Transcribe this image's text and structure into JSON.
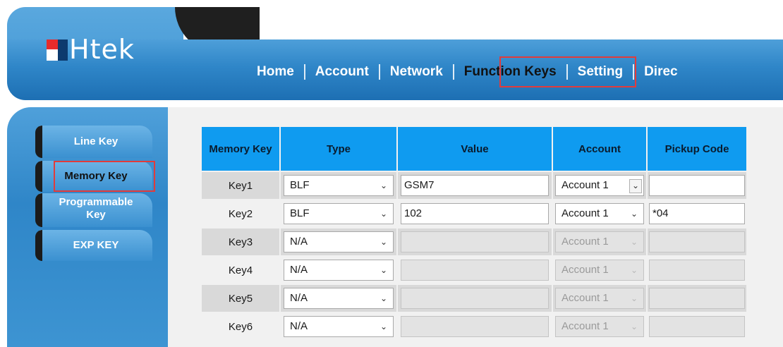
{
  "logo": {
    "text": "Htek"
  },
  "nav": {
    "items": [
      "Home",
      "Account",
      "Network",
      "Function Keys",
      "Setting",
      "Direc"
    ],
    "active": "Function Keys"
  },
  "sidebar": {
    "items": [
      {
        "label": "Line Key"
      },
      {
        "label": "Memory Key"
      },
      {
        "label_line1": "Programmable",
        "label_line2": "Key"
      },
      {
        "label": "EXP KEY"
      }
    ],
    "active": "Memory Key"
  },
  "table": {
    "headers": [
      "Memory Key",
      "Type",
      "Value",
      "Account",
      "Pickup Code"
    ],
    "rows": [
      {
        "key": "Key1",
        "type": "BLF",
        "value": "GSM7",
        "account": "Account 1",
        "pickup": "",
        "enabled": true
      },
      {
        "key": "Key2",
        "type": "BLF",
        "value": "102",
        "account": "Account 1",
        "pickup": "*04",
        "enabled": true
      },
      {
        "key": "Key3",
        "type": "N/A",
        "value": "",
        "account": "Account 1",
        "pickup": "",
        "enabled": false
      },
      {
        "key": "Key4",
        "type": "N/A",
        "value": "",
        "account": "Account 1",
        "pickup": "",
        "enabled": false
      },
      {
        "key": "Key5",
        "type": "N/A",
        "value": "",
        "account": "Account 1",
        "pickup": "",
        "enabled": false
      },
      {
        "key": "Key6",
        "type": "N/A",
        "value": "",
        "account": "Account 1",
        "pickup": "",
        "enabled": false
      }
    ]
  },
  "colors": {
    "header_blue": "#2f86c8",
    "table_header": "#0f9bf0",
    "highlight": "#e23b3b"
  }
}
